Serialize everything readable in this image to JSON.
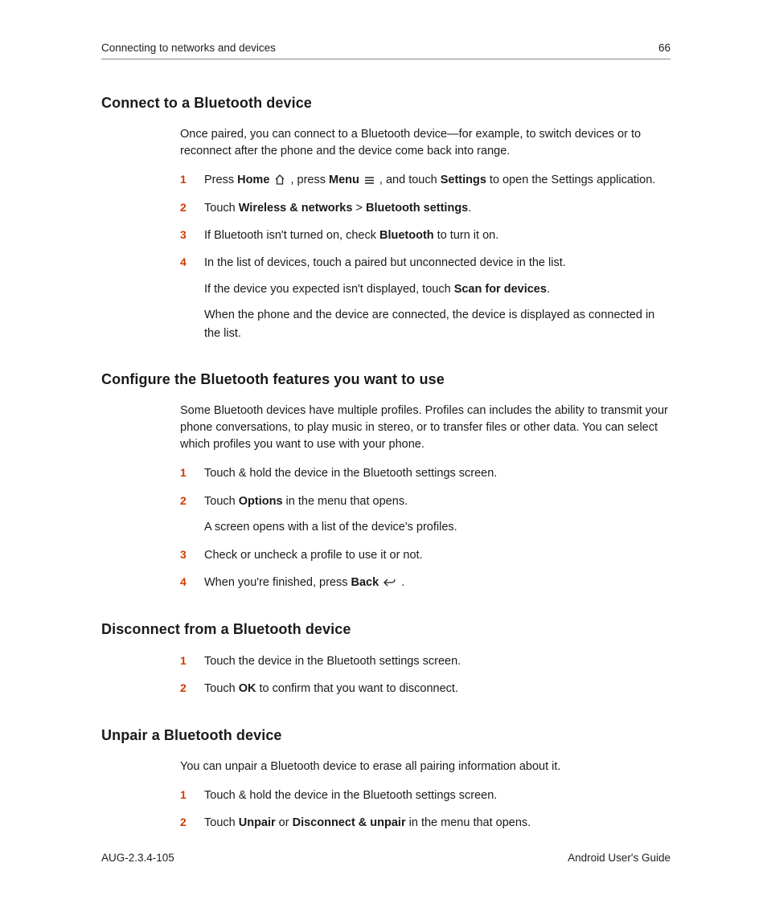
{
  "header": {
    "chapter": "Connecting to networks and devices",
    "page": "66"
  },
  "footer": {
    "docid": "AUG-2.3.4-105",
    "title": "Android User's Guide"
  },
  "s1": {
    "title": "Connect to a Bluetooth device",
    "intro": "Once paired, you can connect to a Bluetooth device—for example, to switch devices or to reconnect after the phone and the device come back into range.",
    "step1_a": "Press ",
    "step1_home": "Home",
    "step1_b": " , press ",
    "step1_menu": "Menu",
    "step1_c": " , and touch ",
    "step1_settings": "Settings",
    "step1_d": " to open the Settings application.",
    "step2_a": "Touch ",
    "step2_wn": "Wireless & networks",
    "step2_gt": " > ",
    "step2_bt": "Bluetooth settings",
    "step2_dot": ".",
    "step3_a": "If Bluetooth isn't turned on, check ",
    "step3_bt": "Bluetooth",
    "step3_b": " to turn it on.",
    "step4": "In the list of devices, touch a paired but unconnected device in the list.",
    "step4_sub1_a": "If the device you expected isn't displayed, touch ",
    "step4_sub1_b": "Scan for devices",
    "step4_sub1_c": ".",
    "step4_sub2": "When the phone and the device are connected, the device is displayed as connected in the list."
  },
  "s2": {
    "title": "Configure the Bluetooth features you want to use",
    "intro": "Some Bluetooth devices have multiple profiles. Profiles can includes the ability to transmit your phone conversations, to play music in stereo, or to transfer files or other data. You can select which profiles you want to use with your phone.",
    "step1": "Touch & hold the device in the Bluetooth settings screen.",
    "step2_a": "Touch ",
    "step2_b": "Options",
    "step2_c": " in the menu that opens.",
    "step2_sub": "A screen opens with a list of the device's profiles.",
    "step3": "Check or uncheck a profile to use it or not.",
    "step4_a": "When you're finished, press ",
    "step4_b": "Back",
    "step4_c": " ."
  },
  "s3": {
    "title": "Disconnect from a Bluetooth device",
    "step1": "Touch the device in the Bluetooth settings screen.",
    "step2_a": "Touch ",
    "step2_b": "OK",
    "step2_c": " to confirm that you want to disconnect."
  },
  "s4": {
    "title": "Unpair a Bluetooth device",
    "intro": "You can unpair a Bluetooth device to erase all pairing information about it.",
    "step1": "Touch & hold the device in the Bluetooth settings screen.",
    "step2_a": "Touch ",
    "step2_unpair": "Unpair",
    "step2_or": " or ",
    "step2_du": "Disconnect & unpair",
    "step2_c": " in the menu that opens."
  },
  "nums": {
    "n1": "1",
    "n2": "2",
    "n3": "3",
    "n4": "4"
  }
}
